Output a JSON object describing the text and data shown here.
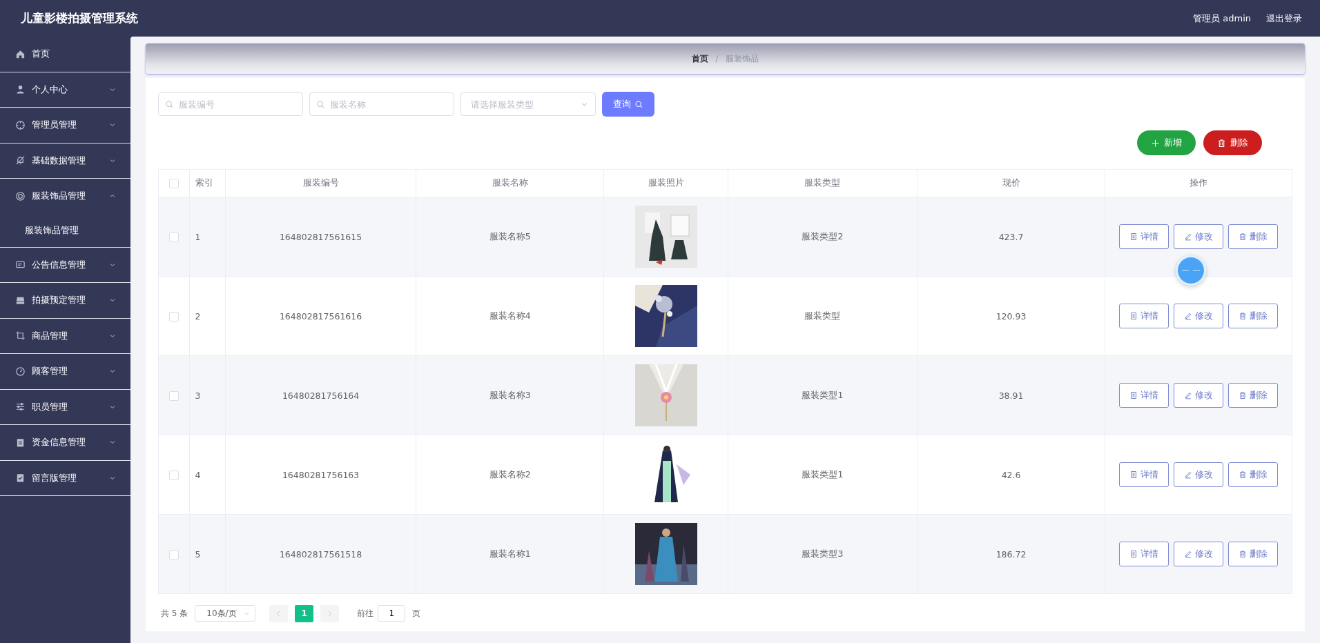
{
  "header": {
    "title": "儿童影楼拍摄管理系统",
    "user": "管理员 admin",
    "logout": "退出登录"
  },
  "sidebar": {
    "items": [
      {
        "label": "首页",
        "kind": "link"
      },
      {
        "label": "个人中心",
        "kind": "group",
        "expanded": false
      },
      {
        "label": "管理员管理",
        "kind": "group",
        "expanded": false
      },
      {
        "label": "基础数据管理",
        "kind": "group",
        "expanded": false
      },
      {
        "label": "服装饰品管理",
        "kind": "group",
        "expanded": true,
        "children": [
          {
            "label": "服装饰品管理"
          }
        ]
      },
      {
        "label": "公告信息管理",
        "kind": "group",
        "expanded": false
      },
      {
        "label": "拍摄预定管理",
        "kind": "group",
        "expanded": false
      },
      {
        "label": "商品管理",
        "kind": "group",
        "expanded": false
      },
      {
        "label": "顾客管理",
        "kind": "group",
        "expanded": false
      },
      {
        "label": "职员管理",
        "kind": "group",
        "expanded": false
      },
      {
        "label": "资金信息管理",
        "kind": "group",
        "expanded": false
      },
      {
        "label": "留言版管理",
        "kind": "group",
        "expanded": false
      }
    ]
  },
  "breadcrumb": [
    {
      "label": "首页",
      "current": false
    },
    {
      "separator": "/"
    },
    {
      "label": "服装饰品",
      "current": true
    }
  ],
  "filters": {
    "code": {
      "placeholder": "服装编号"
    },
    "name": {
      "placeholder": "服装名称"
    },
    "type": {
      "placeholder": "请选择服装类型"
    },
    "search_button": "查询"
  },
  "actions": {
    "add": "新增",
    "delete": "删除"
  },
  "table": {
    "header_checked": false,
    "columns": [
      "索引",
      "服装编号",
      "服装名称",
      "服装照片",
      "服装类型",
      "现价",
      "操作"
    ],
    "rows": [
      {
        "index": "1",
        "code": "164802817561615",
        "name": "服装名称5",
        "type": "服装类型2",
        "price": "423.7",
        "checked": false,
        "actions": [
          "详情",
          "修改",
          "删除"
        ]
      },
      {
        "index": "2",
        "code": "164802817561616",
        "name": "服装名称4",
        "type": "服装类型",
        "price": "120.93",
        "checked": false,
        "actions": [
          "详情",
          "修改",
          "删除"
        ]
      },
      {
        "index": "3",
        "code": "16480281756164",
        "name": "服装名称3",
        "type": "服装类型1",
        "price": "38.91",
        "checked": false,
        "actions": [
          "详情",
          "修改",
          "删除"
        ]
      },
      {
        "index": "4",
        "code": "16480281756163",
        "name": "服装名称2",
        "type": "服装类型1",
        "price": "42.6",
        "checked": false,
        "actions": [
          "详情",
          "修改",
          "删除"
        ]
      },
      {
        "index": "5",
        "code": "164802817561518",
        "name": "服装名称1",
        "type": "服装类型3",
        "price": "186.72",
        "checked": false,
        "actions": [
          "详情",
          "修改",
          "删除"
        ]
      }
    ]
  },
  "pagination": {
    "total": "共 5 条",
    "page_size": "10条/页",
    "prev_disabled": true,
    "next_disabled": true,
    "pages": [
      {
        "label": "1",
        "selected": true
      }
    ],
    "goto_label": "前往",
    "goto_value": "1",
    "goto_suffix": "页"
  }
}
